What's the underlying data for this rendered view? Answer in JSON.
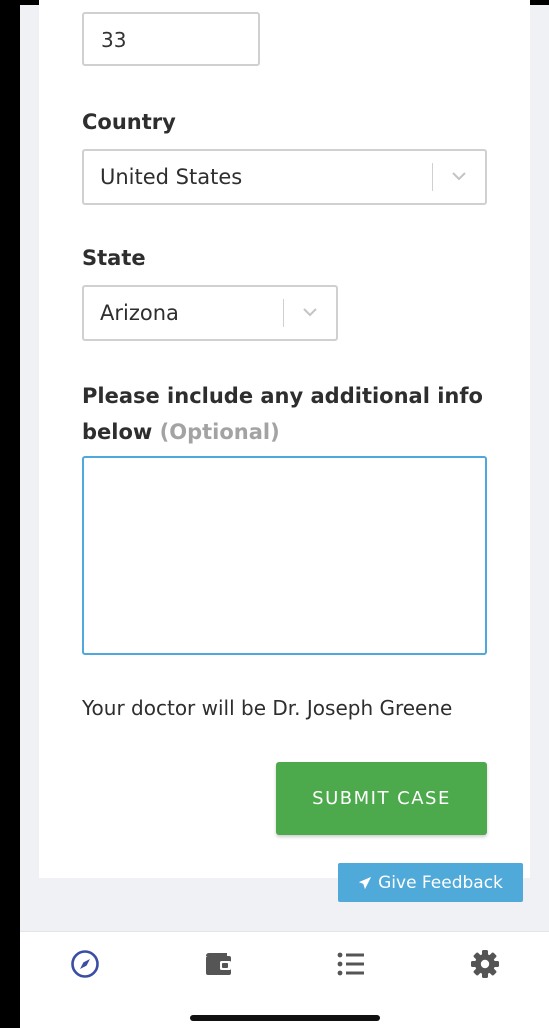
{
  "form": {
    "age_value": "33",
    "country": {
      "label": "Country",
      "selected": "United States"
    },
    "state": {
      "label": "State",
      "selected": "Arizona"
    },
    "additional_info": {
      "label": "Please include any additional info below",
      "optional_text": "(Optional)",
      "value": ""
    },
    "doctor_text": "Your doctor will be Dr. Joseph Greene",
    "submit_label": "SUBMIT CASE"
  },
  "feedback": {
    "label": "Give Feedback",
    "icon": "paper-plane-icon"
  },
  "tabbar": {
    "items": [
      {
        "name": "explore",
        "icon": "compass-icon",
        "active": true
      },
      {
        "name": "wallet",
        "icon": "wallet-icon",
        "active": false
      },
      {
        "name": "list",
        "icon": "list-icon",
        "active": false
      },
      {
        "name": "settings",
        "icon": "gear-icon",
        "active": false
      }
    ],
    "active_color": "#3a4ea3",
    "inactive_color": "#555555"
  },
  "colors": {
    "submit_green": "#4caa4d",
    "feedback_blue": "#4fa9d9",
    "focus_border": "#4fa7dd"
  }
}
